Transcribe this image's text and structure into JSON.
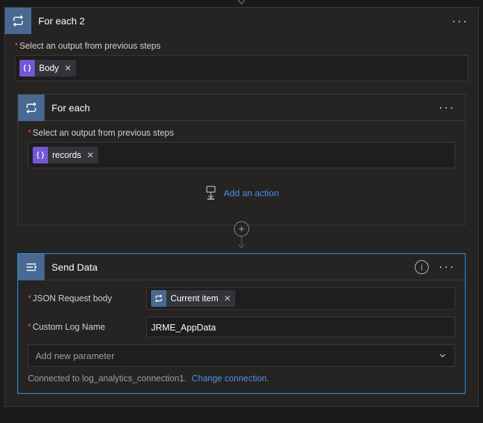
{
  "top_arrow": true,
  "outer": {
    "title": "For each 2",
    "select_label": "Select an output from previous steps",
    "token": {
      "label": "Body",
      "icon": "braces"
    }
  },
  "inner": {
    "title": "For each",
    "select_label": "Select an output from previous steps",
    "token": {
      "label": "records",
      "icon": "braces"
    },
    "add_action_label": "Add an action"
  },
  "send": {
    "title": "Send Data",
    "json_label": "JSON Request body",
    "json_token": {
      "label": "Current item",
      "icon": "loop"
    },
    "log_label": "Custom Log Name",
    "log_value": "JRME_AppData",
    "add_param_label": "Add new parameter",
    "connection_text": "Connected to log_analytics_connection1.",
    "change_link": "Change connection."
  }
}
